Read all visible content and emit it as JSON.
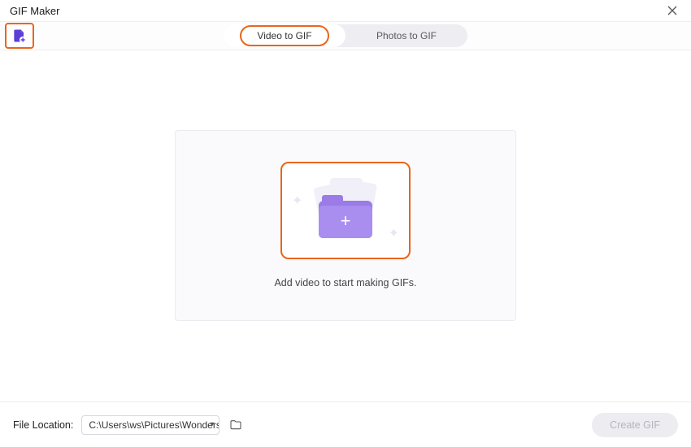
{
  "title": "GIF Maker",
  "tabs": {
    "active": "Video to GIF",
    "inactive": "Photos to GIF"
  },
  "dropzone": {
    "hint": "Add video to start making GIFs."
  },
  "footer": {
    "label": "File Location:",
    "path": "C:\\Users\\ws\\Pictures\\Wonders",
    "create_btn": "Create GIF"
  }
}
